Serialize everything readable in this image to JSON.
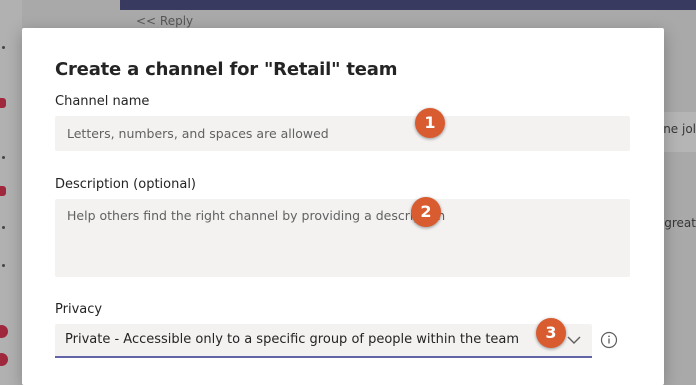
{
  "background": {
    "reply_text": "<< Reply",
    "right_snippet_1": "ne jol",
    "right_snippet_2": "great"
  },
  "dialog": {
    "title": "Create a channel for \"Retail\" team",
    "channel_name": {
      "label": "Channel name",
      "placeholder": "Letters, numbers, and spaces are allowed"
    },
    "description": {
      "label": "Description (optional)",
      "placeholder": "Help others find the right channel by providing a description"
    },
    "privacy": {
      "label": "Privacy",
      "selected": "Private - Accessible only to a specific group of people within the team"
    }
  },
  "markers": [
    "1",
    "2",
    "3"
  ],
  "colors": {
    "accent": "#6264a7",
    "marker": "#d95b30",
    "field_bg": "#f3f2f1"
  }
}
